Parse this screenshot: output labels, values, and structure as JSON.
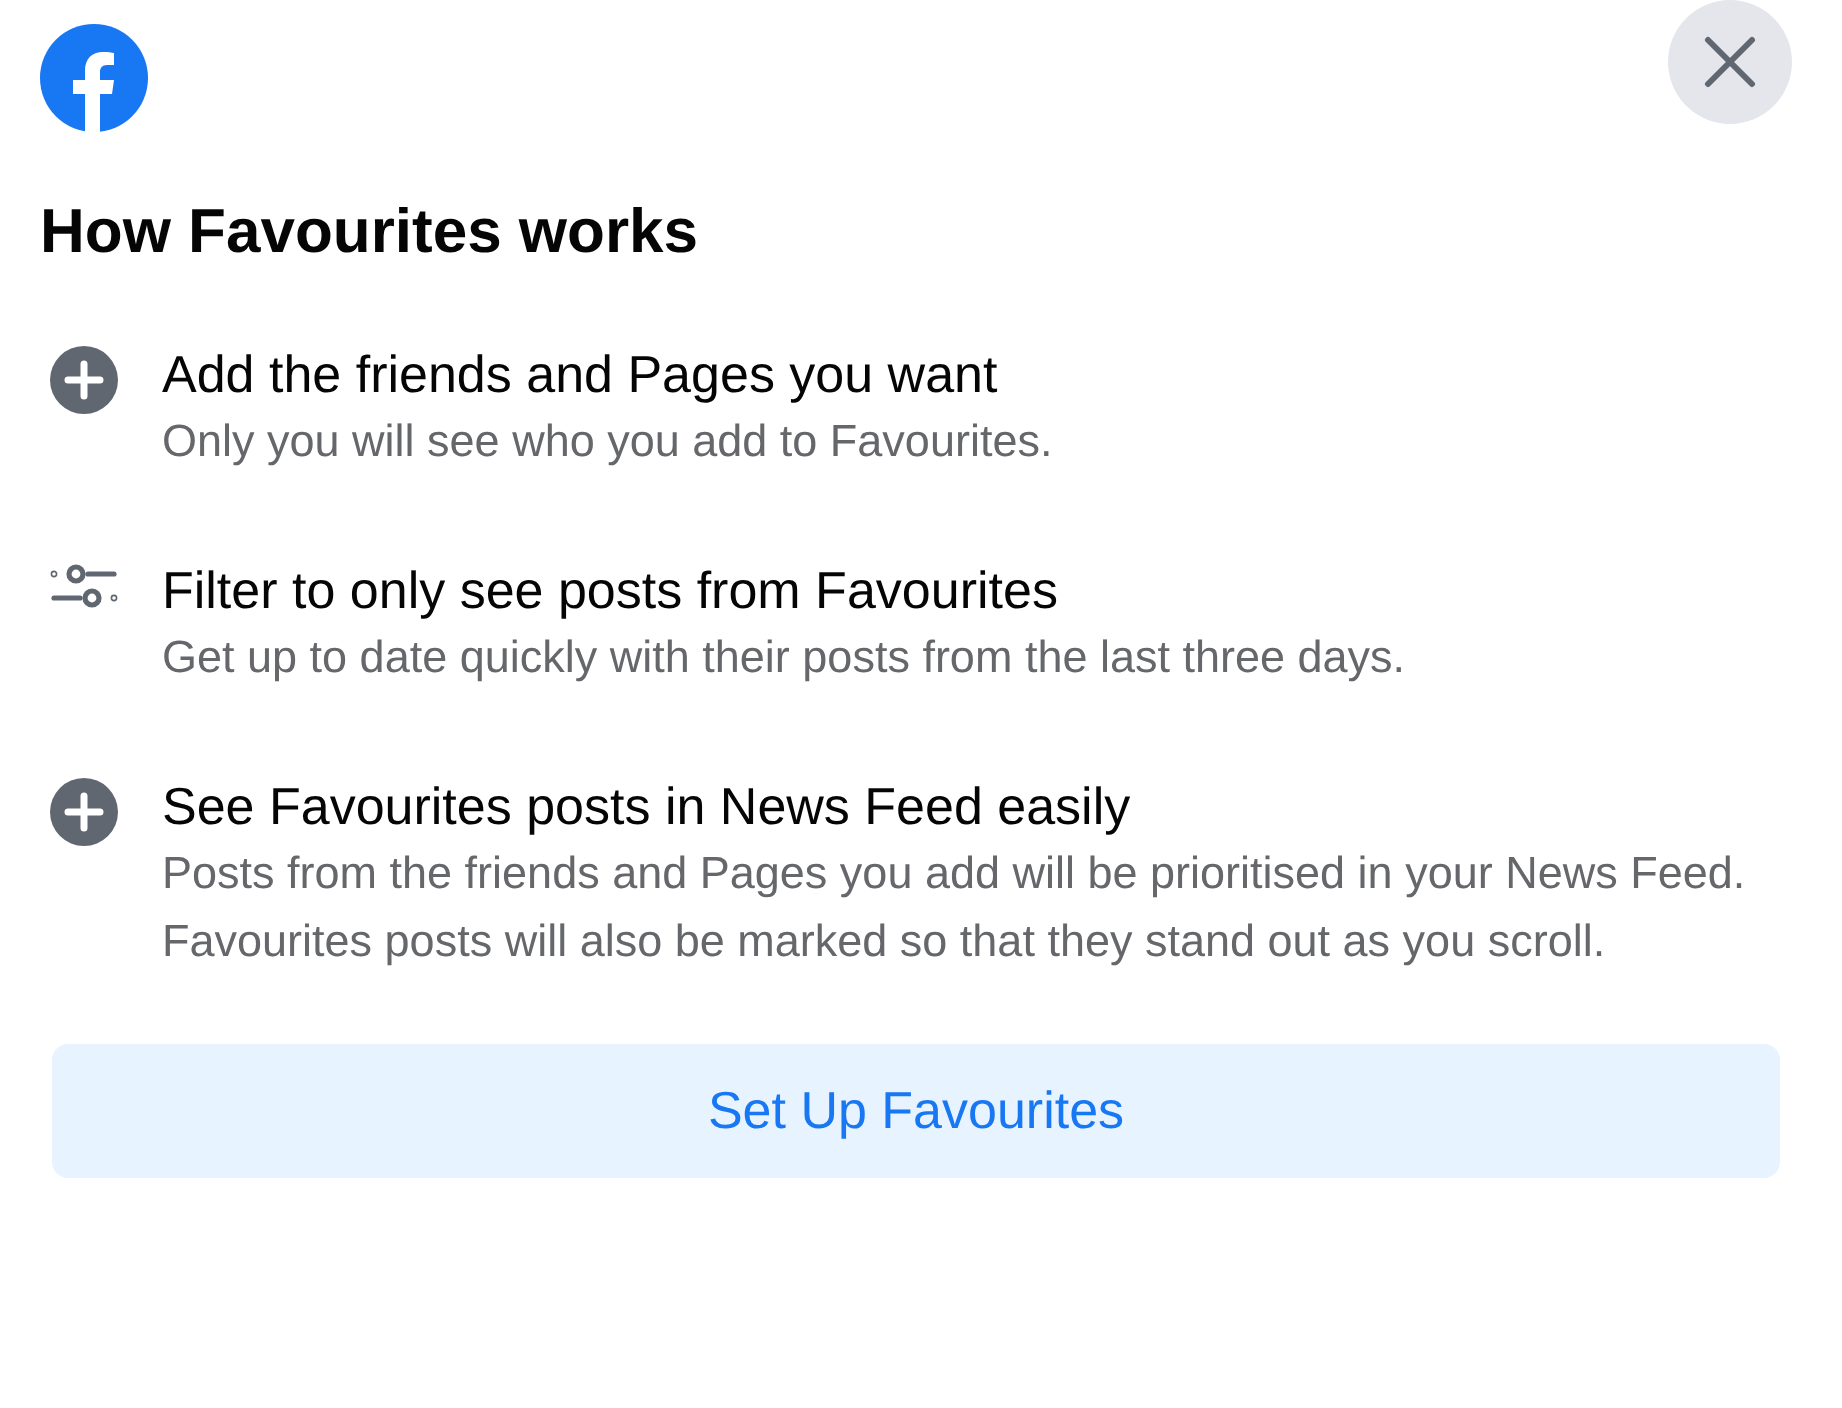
{
  "heading": "How Favourites works",
  "items": [
    {
      "kind": "plus",
      "title": "Add the friends and Pages you want",
      "description": "Only you will see who you add to Favourites."
    },
    {
      "kind": "filter",
      "title": "Filter to only see posts from Favourites",
      "description": "Get up to date quickly with their posts from the last three days."
    },
    {
      "kind": "plus",
      "title": "See Favourites posts in News Feed easily",
      "description": "Posts from the friends and Pages you add will be prioritised in your News Feed. Favourites posts will also be marked so that they stand out as you scroll."
    }
  ],
  "button": "Set Up Favourites"
}
